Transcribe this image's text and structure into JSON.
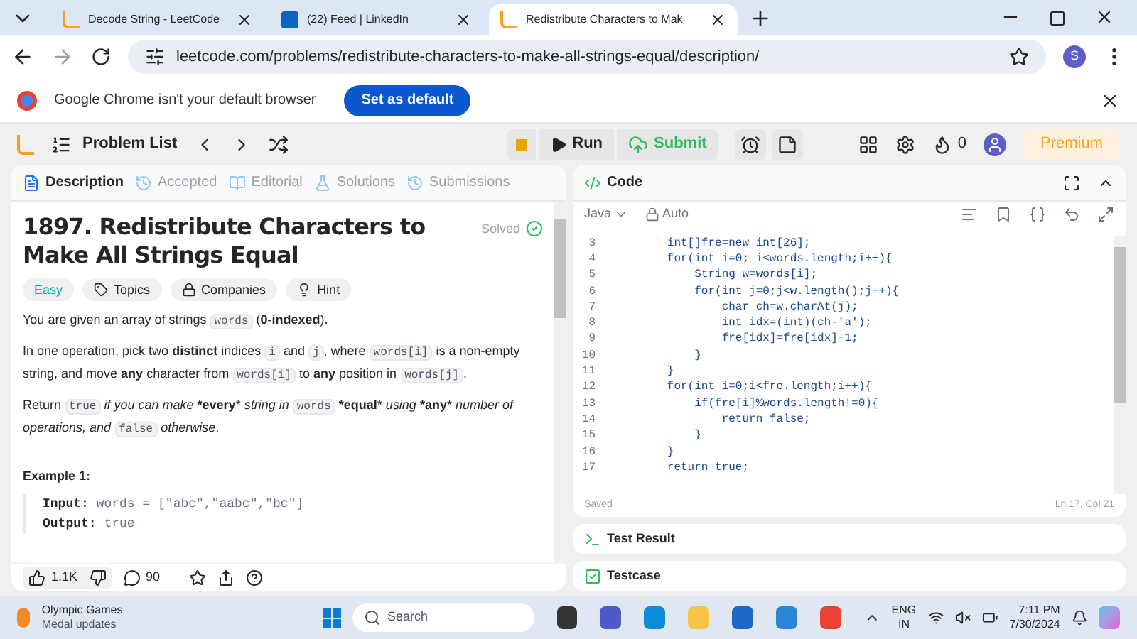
{
  "browser": {
    "tabs": [
      {
        "title": "Decode String - LeetCode",
        "kind": "leetcode",
        "selected": false
      },
      {
        "title": "(22) Feed | LinkedIn",
        "kind": "linkedin",
        "selected": false
      },
      {
        "title": "Redistribute Characters to Mak",
        "kind": "leetcode",
        "selected": true
      }
    ],
    "url": "leetcode.com/problems/redistribute-characters-to-make-all-strings-equal/description/",
    "profile": "S",
    "infobar": {
      "message": "Google Chrome isn't your default browser",
      "button": "Set as default"
    }
  },
  "nav": {
    "problem_list": "Problem List",
    "run": "Run",
    "submit": "Submit",
    "streak": "0",
    "premium": "Premium"
  },
  "left": {
    "tabs": [
      {
        "label": "Description",
        "selected": true
      },
      {
        "label": "Accepted",
        "selected": false
      },
      {
        "label": "Editorial",
        "selected": false
      },
      {
        "label": "Solutions",
        "selected": false
      },
      {
        "label": "Submissions",
        "selected": false
      }
    ],
    "title": "1897. Redistribute Characters to Make All Strings Equal",
    "status": "Solved",
    "tags": [
      {
        "label": "Easy",
        "kind": "difficulty"
      },
      {
        "label": "Topics",
        "kind": "topics"
      },
      {
        "label": "Companies",
        "kind": "companies"
      },
      {
        "label": "Hint",
        "kind": "hint"
      }
    ],
    "paragraphs": [
      [
        {
          "kind": "text",
          "t": "You are given an array of strings "
        },
        {
          "kind": "code",
          "t": "words"
        },
        {
          "kind": "text",
          "t": " (**0-indexed**)."
        }
      ],
      [
        {
          "kind": "text",
          "t": "In one operation, pick two **distinct** indices "
        },
        {
          "kind": "code",
          "t": "i"
        },
        {
          "kind": "text",
          "t": " and "
        },
        {
          "kind": "code",
          "t": "j"
        },
        {
          "kind": "text",
          "t": ", where "
        },
        {
          "kind": "code",
          "t": "words[i]"
        },
        {
          "kind": "text",
          "t": " is a non-empty string, and move **any** character from "
        },
        {
          "kind": "code",
          "t": "words[i]"
        },
        {
          "kind": "text",
          "t": " to **any** position in "
        },
        {
          "kind": "code",
          "t": "words[j]"
        },
        {
          "kind": "text",
          "t": "."
        }
      ],
      [
        {
          "kind": "text",
          "t": "Return "
        },
        {
          "kind": "code",
          "t": "true"
        },
        {
          "kind": "text",
          "t": " *if you can make* ***every*** *string in* "
        },
        {
          "kind": "code",
          "t": "words"
        },
        {
          "kind": "text",
          "t": " ***equal*** *using* ***any*** *number of operations, and* "
        },
        {
          "kind": "code",
          "t": "false"
        },
        {
          "kind": "text",
          "t": " *otherwise*."
        }
      ]
    ],
    "example": {
      "heading": "Example 1:",
      "lines": [
        {
          "label": "Input:",
          "value": "words = [\"abc\",\"aabc\",\"bc\"]"
        },
        {
          "label": "Output:",
          "value": "true"
        }
      ]
    },
    "likes": "1.1K",
    "comments": "90"
  },
  "editor": {
    "title": "Code",
    "language": "Java",
    "mode": "Auto",
    "lines": [
      {
        "n": "3",
        "t": "        int[]fre=new int[26];"
      },
      {
        "n": "4",
        "t": "        for(int i=0; i<words.length;i++){"
      },
      {
        "n": "5",
        "t": "            String w=words[i];"
      },
      {
        "n": "6",
        "t": "            for(int j=0;j<w.length();j++){"
      },
      {
        "n": "7",
        "t": "                char ch=w.charAt(j);"
      },
      {
        "n": "8",
        "t": "                int idx=(int)(ch-'a');"
      },
      {
        "n": "9",
        "t": "                fre[idx]=fre[idx]+1;"
      },
      {
        "n": "10",
        "t": "            }"
      },
      {
        "n": "11",
        "t": "        }"
      },
      {
        "n": "12",
        "t": "        for(int i=0;i<fre.length;i++){"
      },
      {
        "n": "13",
        "t": "            if(fre[i]%words.length!=0){"
      },
      {
        "n": "14",
        "t": "                return false;"
      },
      {
        "n": "15",
        "t": "            }"
      },
      {
        "n": "16",
        "t": "        }"
      },
      {
        "n": "17",
        "t": "        return true;"
      }
    ],
    "saved": "Saved",
    "cursor": "Ln 17, Col 21"
  },
  "panels": [
    {
      "title": "Test Result",
      "kind": "result"
    },
    {
      "title": "Testcase",
      "kind": "testcase"
    }
  ],
  "taskbar": {
    "news_title": "Olympic Games",
    "news_sub": "Medal updates",
    "search": "Search",
    "lang": "ENG",
    "region": "IN",
    "time": "7:11 PM",
    "date": "7/30/2024"
  }
}
